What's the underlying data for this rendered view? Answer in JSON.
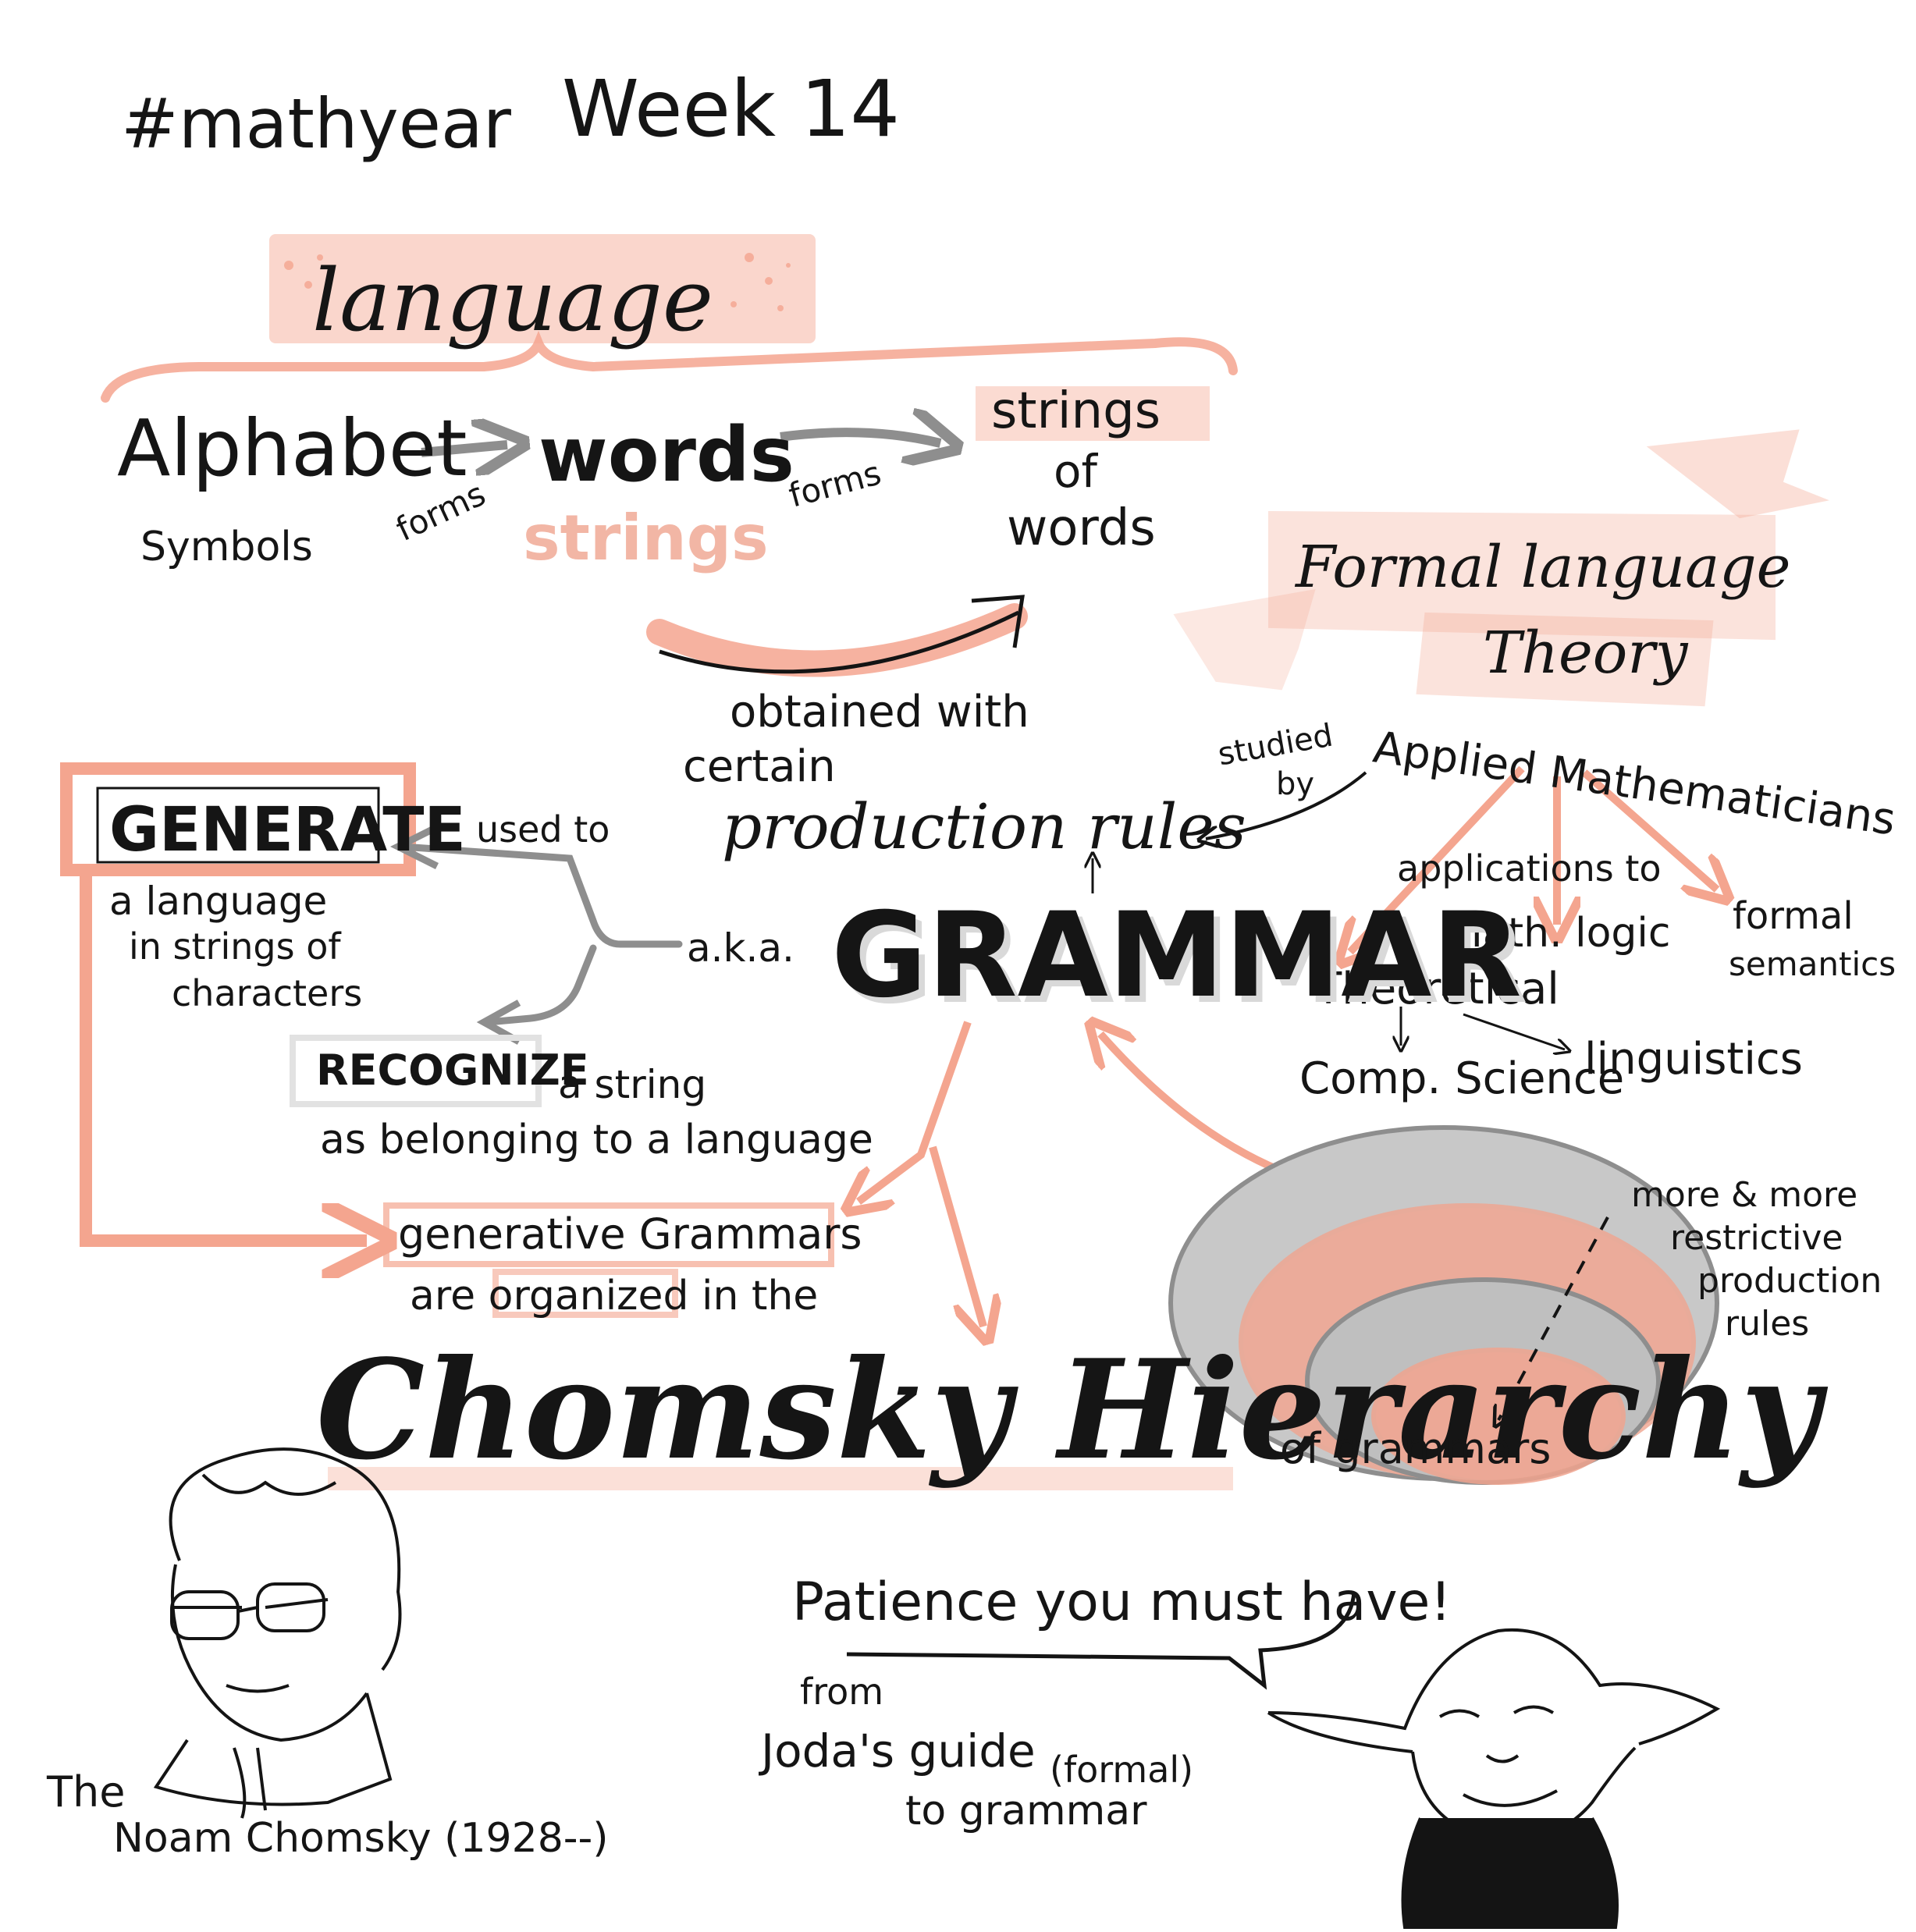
{
  "header": {
    "hashtag": "#mathyear",
    "week": "Week 14"
  },
  "colors": {
    "ink": "#141414",
    "accent_pink": "#f4a58f",
    "gray": "#8e8e8e",
    "paper": "#ffffff"
  },
  "language": {
    "title": "language",
    "alphabet": "Alphabet",
    "symbols": "Symbols",
    "forms_1": "forms",
    "words": "words",
    "strings": "strings",
    "forms_2": "forms",
    "strings_of_words": [
      "strings",
      "of",
      "words"
    ],
    "obtained_with": [
      "obtained with",
      "certain"
    ],
    "production_rules": "production rules"
  },
  "formal_language_theory": {
    "banner": [
      "Formal language",
      "Theory"
    ],
    "studied_by": [
      "studied",
      "by"
    ],
    "applied_mathematicians": "Applied Mathematicians",
    "applications_to": "applications to",
    "math_logic": "Math. logic",
    "formal_semantics": [
      "formal",
      "semantics"
    ],
    "theoretical": "Theoretical",
    "comp_science": "Comp. Science",
    "linguistics": "linguistics"
  },
  "grammar": {
    "title": "GRAMMAR",
    "aka": "a.k.a.",
    "used_to": "used to",
    "generate": "GENERATE",
    "generate_desc": [
      "a language",
      "in strings of",
      "characters"
    ],
    "recognize": "RECOGNIZE",
    "recognize_desc": [
      "a string",
      "as belonging to a language"
    ],
    "generative": [
      "generative Grammars",
      "are organized in the"
    ]
  },
  "chomsky": {
    "title": "Chomsky Hierarchy",
    "of_grammars": "of grammars",
    "restrictive": [
      "more & more",
      "restrictive",
      "production",
      "rules"
    ]
  },
  "portrait": {
    "the": "The",
    "name": "Noam Chomsky (1928--)"
  },
  "yoda": {
    "quote": "Patience you must have!",
    "from": "from",
    "guide": "Joda's guide",
    "formal": "(formal)",
    "to_grammar": "to grammar"
  }
}
